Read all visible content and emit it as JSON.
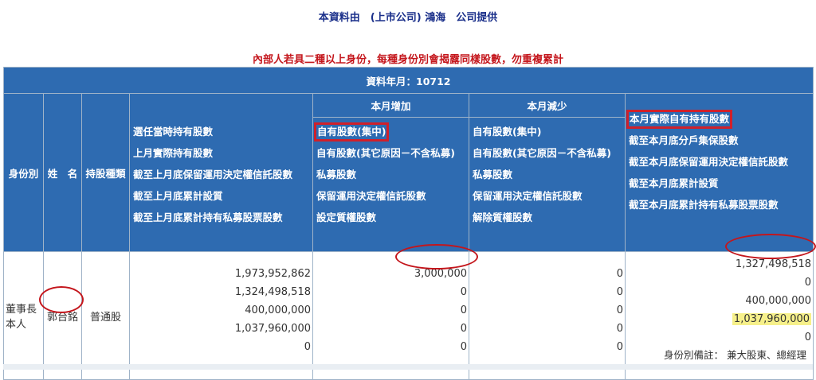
{
  "header": {
    "source_line": "本資料由　(上市公司) 鴻海　公司提供",
    "note": "內部人若具二種以上身份，每種身份別會揭露同樣股數，勿重複累計"
  },
  "table": {
    "year_month_label": "資料年月：10712",
    "col_identity": "身份別",
    "col_name": "姓　名",
    "col_share_type": "持股種類",
    "col_increase": "本月增加",
    "col_decrease": "本月減少",
    "holding_labels": [
      "選任當時持有股數",
      "上月實際持有股數",
      "截至上月底保留運用決定權信託股數",
      "截至上月底累計設質",
      "截至上月底累計持有私募股票股數"
    ],
    "increase_labels": [
      "自有股數(集中)",
      "自有股數(其它原因－不含私募)",
      "私募股數",
      "保留運用決定權信託股數",
      "設定質權股數"
    ],
    "decrease_labels": [
      "自有股數(集中)",
      "自有股數(其它原因－不含私募)",
      "私募股數",
      "保留運用決定權信託股數",
      "解除質權股數"
    ],
    "current_labels": [
      "本月實際自有持有股數",
      "截至本月底分戶集保股數",
      "截至本月底保留運用決定權信託股數",
      "截至本月底累計設質",
      "截至本月底累計持有私募股票股數"
    ]
  },
  "row": {
    "identity": "董事長本人",
    "name": "郭台銘",
    "share_type": "普通股",
    "holding_values": [
      "1,973,952,862",
      "1,324,498,518",
      "400,000,000",
      "1,037,960,000",
      "0"
    ],
    "increase_values": [
      "3,000,000",
      "0",
      "0",
      "0",
      "0"
    ],
    "decrease_values": [
      "0",
      "0",
      "0",
      "0",
      "0"
    ],
    "current_values": [
      "1,327,498,518",
      "0",
      "400,000,000",
      "1,037,960,000",
      "0"
    ],
    "identity_note": "身份別備註：  兼大股東、總經理"
  },
  "colors": {
    "header_bg": "#2e6bb1",
    "title_color": "#1a2f8a",
    "note_color": "#c4161c",
    "annotation_red": "#d0202a",
    "highlight_yellow": "#f6f08a"
  }
}
